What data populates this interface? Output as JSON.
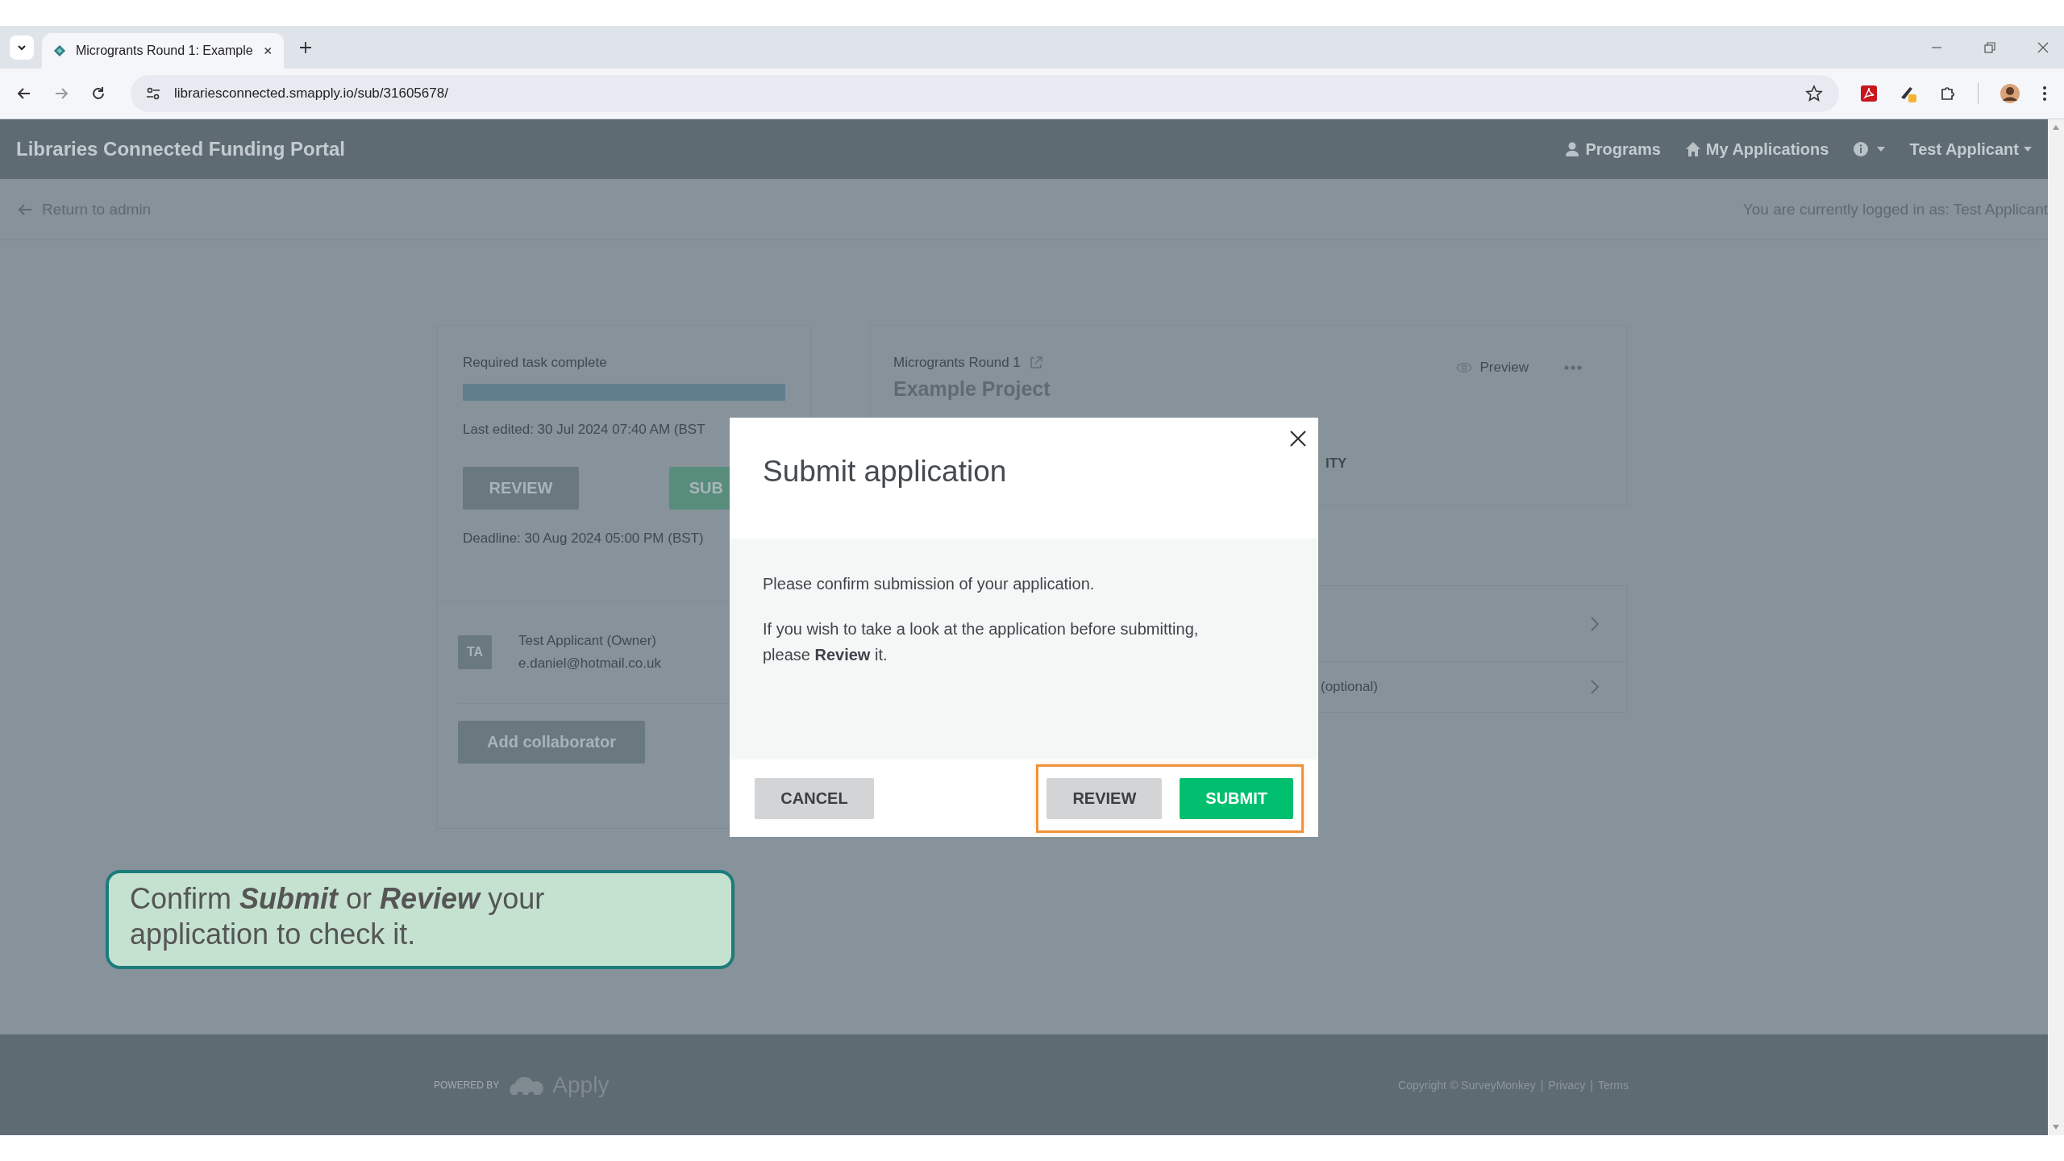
{
  "browser": {
    "tab_title": "Microgrants Round 1: Example",
    "url": "librariesconnected.smapply.io/sub/31605678/"
  },
  "header": {
    "title": "Libraries Connected Funding Portal",
    "nav": [
      {
        "label": "Programs"
      },
      {
        "label": "My Applications"
      }
    ],
    "user": "Test Applicant"
  },
  "subbar": {
    "back_link": "Return to admin",
    "logged_in": "You are currently logged in as: Test Applicant"
  },
  "left_card": {
    "status": "Required task complete",
    "progress": {
      "level": 1
    },
    "last_edited": "Last edited: 30 Jul 2024 07:40 AM (BST",
    "review_button": "REVIEW",
    "submit_button": "SUB",
    "deadline": "Deadline: 30 Aug 2024 05:00 PM (BST)",
    "collaborator": {
      "initials": "TA",
      "name": "Test Applicant (Owner)",
      "email": "e.daniel@hotmail.co.uk"
    },
    "add_button": "Add collaborator"
  },
  "right_card": {
    "program": "Microgrants Round 1",
    "preview": "Preview",
    "title": "Example Project",
    "tab_fragment": "ITY"
  },
  "list_rows": [
    {},
    {
      "label": "(optional)"
    }
  ],
  "modal": {
    "title": "Submit application",
    "paragraphs": [
      "Please confirm submission of your application.",
      "If you wish to take a look at the application before submitting, please **Review** it."
    ],
    "left_buttons": [
      {
        "label": "CANCEL",
        "kind": "secondary"
      }
    ],
    "right_buttons": [
      {
        "label": "REVIEW",
        "kind": "secondary"
      },
      {
        "label": "SUBMIT",
        "kind": "primary"
      }
    ],
    "right_highlighted": true
  },
  "callout": {
    "text": "Confirm **Submit** or **Review** your application to check it."
  },
  "footer": {
    "powered_by": "POWERED BY",
    "brand": "Apply",
    "copyright": "Copyright © SurveyMonkey",
    "separator": "|",
    "links": [
      "Privacy",
      "Terms"
    ]
  }
}
